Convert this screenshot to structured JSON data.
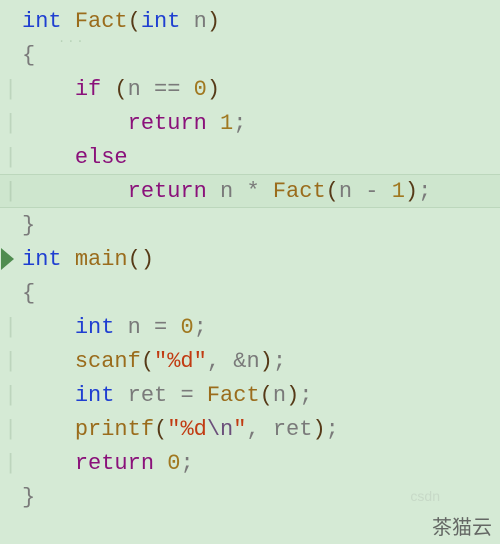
{
  "code": {
    "l1": {
      "kw1": "int",
      "sp1": " ",
      "fn": "Fact",
      "po": "(",
      "kw2": "int",
      "sp2": " ",
      "id": "n",
      "pc": ")"
    },
    "l2": {
      "brace": "{"
    },
    "l3": {
      "indent": "    ",
      "kw": "if",
      "sp": " ",
      "po": "(",
      "id": "n",
      "sp2": " ",
      "op": "==",
      "sp3": " ",
      "num": "0",
      "pc": ")"
    },
    "l4": {
      "indent": "        ",
      "kw": "return",
      "sp": " ",
      "num": "1",
      "semi": ";"
    },
    "l5": {
      "indent": "    ",
      "kw": "else"
    },
    "l6": {
      "indent": "        ",
      "kw": "return",
      "sp": " ",
      "id": "n",
      "sp2": " ",
      "op": "*",
      "sp3": " ",
      "fn": "Fact",
      "po": "(",
      "id2": "n",
      "sp4": " ",
      "op2": "-",
      "sp5": " ",
      "num": "1",
      "pc": ")",
      "semi": ";"
    },
    "l7": {
      "brace": "}"
    },
    "l8": {
      "kw1": "int",
      "sp1": " ",
      "fn": "main",
      "po": "(",
      "pc": ")"
    },
    "l9": {
      "brace": "{"
    },
    "l10": {
      "indent": "    ",
      "kw": "int",
      "sp": " ",
      "id": "n",
      "sp2": " ",
      "op": "=",
      "sp3": " ",
      "num": "0",
      "semi": ";"
    },
    "l11": {
      "indent": "    ",
      "fn": "scanf",
      "po": "(",
      "str": "\"%d\"",
      "comma": ",",
      "sp": " ",
      "amp": "&",
      "id": "n",
      "pc": ")",
      "semi": ";"
    },
    "l12": {
      "indent": "    ",
      "kw": "int",
      "sp": " ",
      "id": "ret",
      "sp2": " ",
      "op": "=",
      "sp3": " ",
      "fn": "Fact",
      "po": "(",
      "id2": "n",
      "pc": ")",
      "semi": ";"
    },
    "l13": {
      "indent": "    ",
      "fn": "printf",
      "po": "(",
      "q1": "\"",
      "s1": "%d",
      "esc": "\\n",
      "q2": "\"",
      "comma": ",",
      "sp": " ",
      "id": "ret",
      "pc": ")",
      "semi": ";"
    },
    "l14": {
      "indent": "    ",
      "kw": "return",
      "sp": " ",
      "num": "0",
      "semi": ";"
    },
    "l15": {
      "brace": "}"
    }
  },
  "watermark": "茶猫云",
  "dots": "..."
}
